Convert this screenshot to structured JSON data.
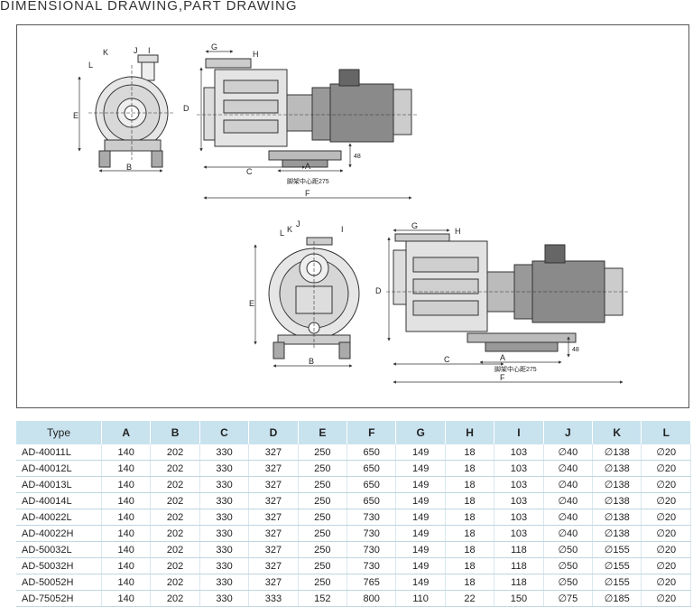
{
  "page": {
    "title": "DIMENSIONAL DRAWING,PART DRAWING"
  },
  "drawing1": {
    "labels": {
      "A": "A",
      "B": "B",
      "C": "C",
      "D": "D",
      "E": "E",
      "F": "F",
      "G": "G",
      "H": "H",
      "I": "I",
      "J": "J",
      "K": "K",
      "L": "L",
      "dim48": "48",
      "base_note": "脚架中心距275"
    }
  },
  "drawing2": {
    "labels": {
      "A": "A",
      "B": "B",
      "C": "C",
      "D": "D",
      "E": "E",
      "F": "F",
      "G": "G",
      "H": "H",
      "I": "I",
      "J": "J",
      "K": "K",
      "L": "L",
      "dim48": "48",
      "base_note": "脚架中心距275"
    }
  },
  "table": {
    "headers": [
      "Type",
      "A",
      "B",
      "C",
      "D",
      "E",
      "F",
      "G",
      "H",
      "I",
      "J",
      "K",
      "L"
    ],
    "rows": [
      [
        "AD-40011L",
        "140",
        "202",
        "330",
        "327",
        "250",
        "650",
        "149",
        "18",
        "103",
        "∅40",
        "∅138",
        "∅20"
      ],
      [
        "AD-40012L",
        "140",
        "202",
        "330",
        "327",
        "250",
        "650",
        "149",
        "18",
        "103",
        "∅40",
        "∅138",
        "∅20"
      ],
      [
        "AD-40013L",
        "140",
        "202",
        "330",
        "327",
        "250",
        "650",
        "149",
        "18",
        "103",
        "∅40",
        "∅138",
        "∅20"
      ],
      [
        "AD-40014L",
        "140",
        "202",
        "330",
        "327",
        "250",
        "650",
        "149",
        "18",
        "103",
        "∅40",
        "∅138",
        "∅20"
      ],
      [
        "AD-40022L",
        "140",
        "202",
        "330",
        "327",
        "250",
        "730",
        "149",
        "18",
        "103",
        "∅40",
        "∅138",
        "∅20"
      ],
      [
        "AD-40022H",
        "140",
        "202",
        "330",
        "327",
        "250",
        "730",
        "149",
        "18",
        "103",
        "∅40",
        "∅138",
        "∅20"
      ],
      [
        "AD-50032L",
        "140",
        "202",
        "330",
        "327",
        "250",
        "730",
        "149",
        "18",
        "118",
        "∅50",
        "∅155",
        "∅20"
      ],
      [
        "AD-50032H",
        "140",
        "202",
        "330",
        "327",
        "250",
        "730",
        "149",
        "18",
        "118",
        "∅50",
        "∅155",
        "∅20"
      ],
      [
        "AD-50052H",
        "140",
        "202",
        "330",
        "327",
        "250",
        "765",
        "149",
        "18",
        "118",
        "∅50",
        "∅155",
        "∅20"
      ],
      [
        "AD-75052H",
        "140",
        "202",
        "330",
        "333",
        "152",
        "800",
        "110",
        "22",
        "150",
        "∅75",
        "∅185",
        "∅20"
      ]
    ]
  },
  "colors": {
    "header_bg": "#c8e2ee",
    "line": "#333333"
  }
}
